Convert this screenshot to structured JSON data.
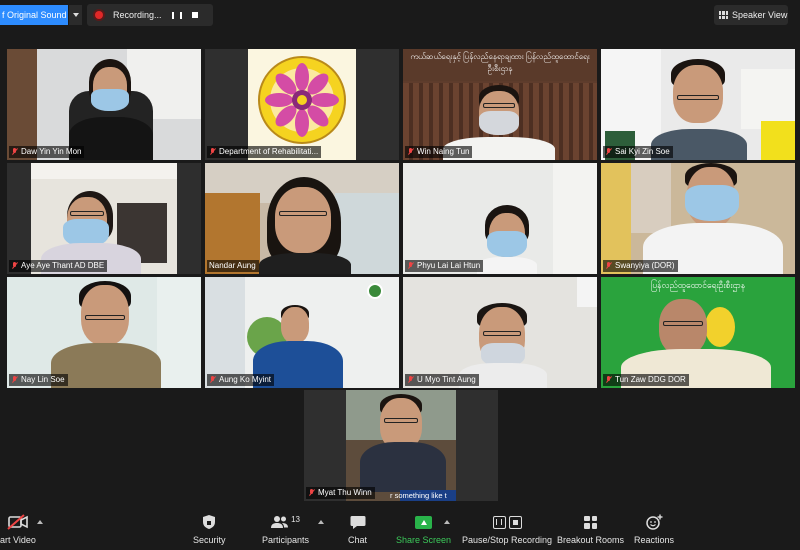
{
  "topbar": {
    "original_sound_label": "f Original Sound",
    "recording_label": "Recording...",
    "speaker_view_label": "Speaker View"
  },
  "participants": [
    {
      "name": "Daw Yin Yin Mon",
      "muted": true
    },
    {
      "name": "Department of Rehabilitati...",
      "muted": true
    },
    {
      "name": "Win Naing Tun",
      "muted": true
    },
    {
      "name": "Sai Kyi Zin Soe",
      "muted": true
    },
    {
      "name": "Aye Aye Thant AD DBE",
      "muted": true
    },
    {
      "name": "Nandar Aung",
      "muted": false
    },
    {
      "name": "Phyu Lai Lai Htun",
      "muted": true
    },
    {
      "name": "Swanyiya (DOR)",
      "muted": true
    },
    {
      "name": "Nay Lin Soe",
      "muted": true
    },
    {
      "name": "Aung Ko Myint",
      "muted": true
    },
    {
      "name": "U Myo Tint Aung",
      "muted": true
    },
    {
      "name": "Tun Zaw DDG DOR",
      "muted": true
    },
    {
      "name": "Myat Thu Winn",
      "muted": true
    }
  ],
  "banners": {
    "tile3": "ကယ်ဆယ်ရေးနှင့် ပြန်လည်နေရာချထား ပြန်လည်ထူထောင်ရေးဦးစီးဌာန",
    "tile12": "ပြန်လည်ထူထောင်ရေးဦးစီးဌာန"
  },
  "caption": "r something like t",
  "toolbar": {
    "video_label": "art Video",
    "security_label": "Security",
    "participants_label": "Participants",
    "participants_count": "13",
    "chat_label": "Chat",
    "share_label": "Share Screen",
    "record_label": "Pause/Stop Recording",
    "breakout_label": "Breakout Rooms",
    "reactions_label": "Reactions"
  },
  "colors": {
    "accent": "#2d8cff",
    "active_speaker": "#d7e84a",
    "share_green": "#29b34a",
    "muted_red": "#e44444",
    "record_red": "#e02828"
  }
}
